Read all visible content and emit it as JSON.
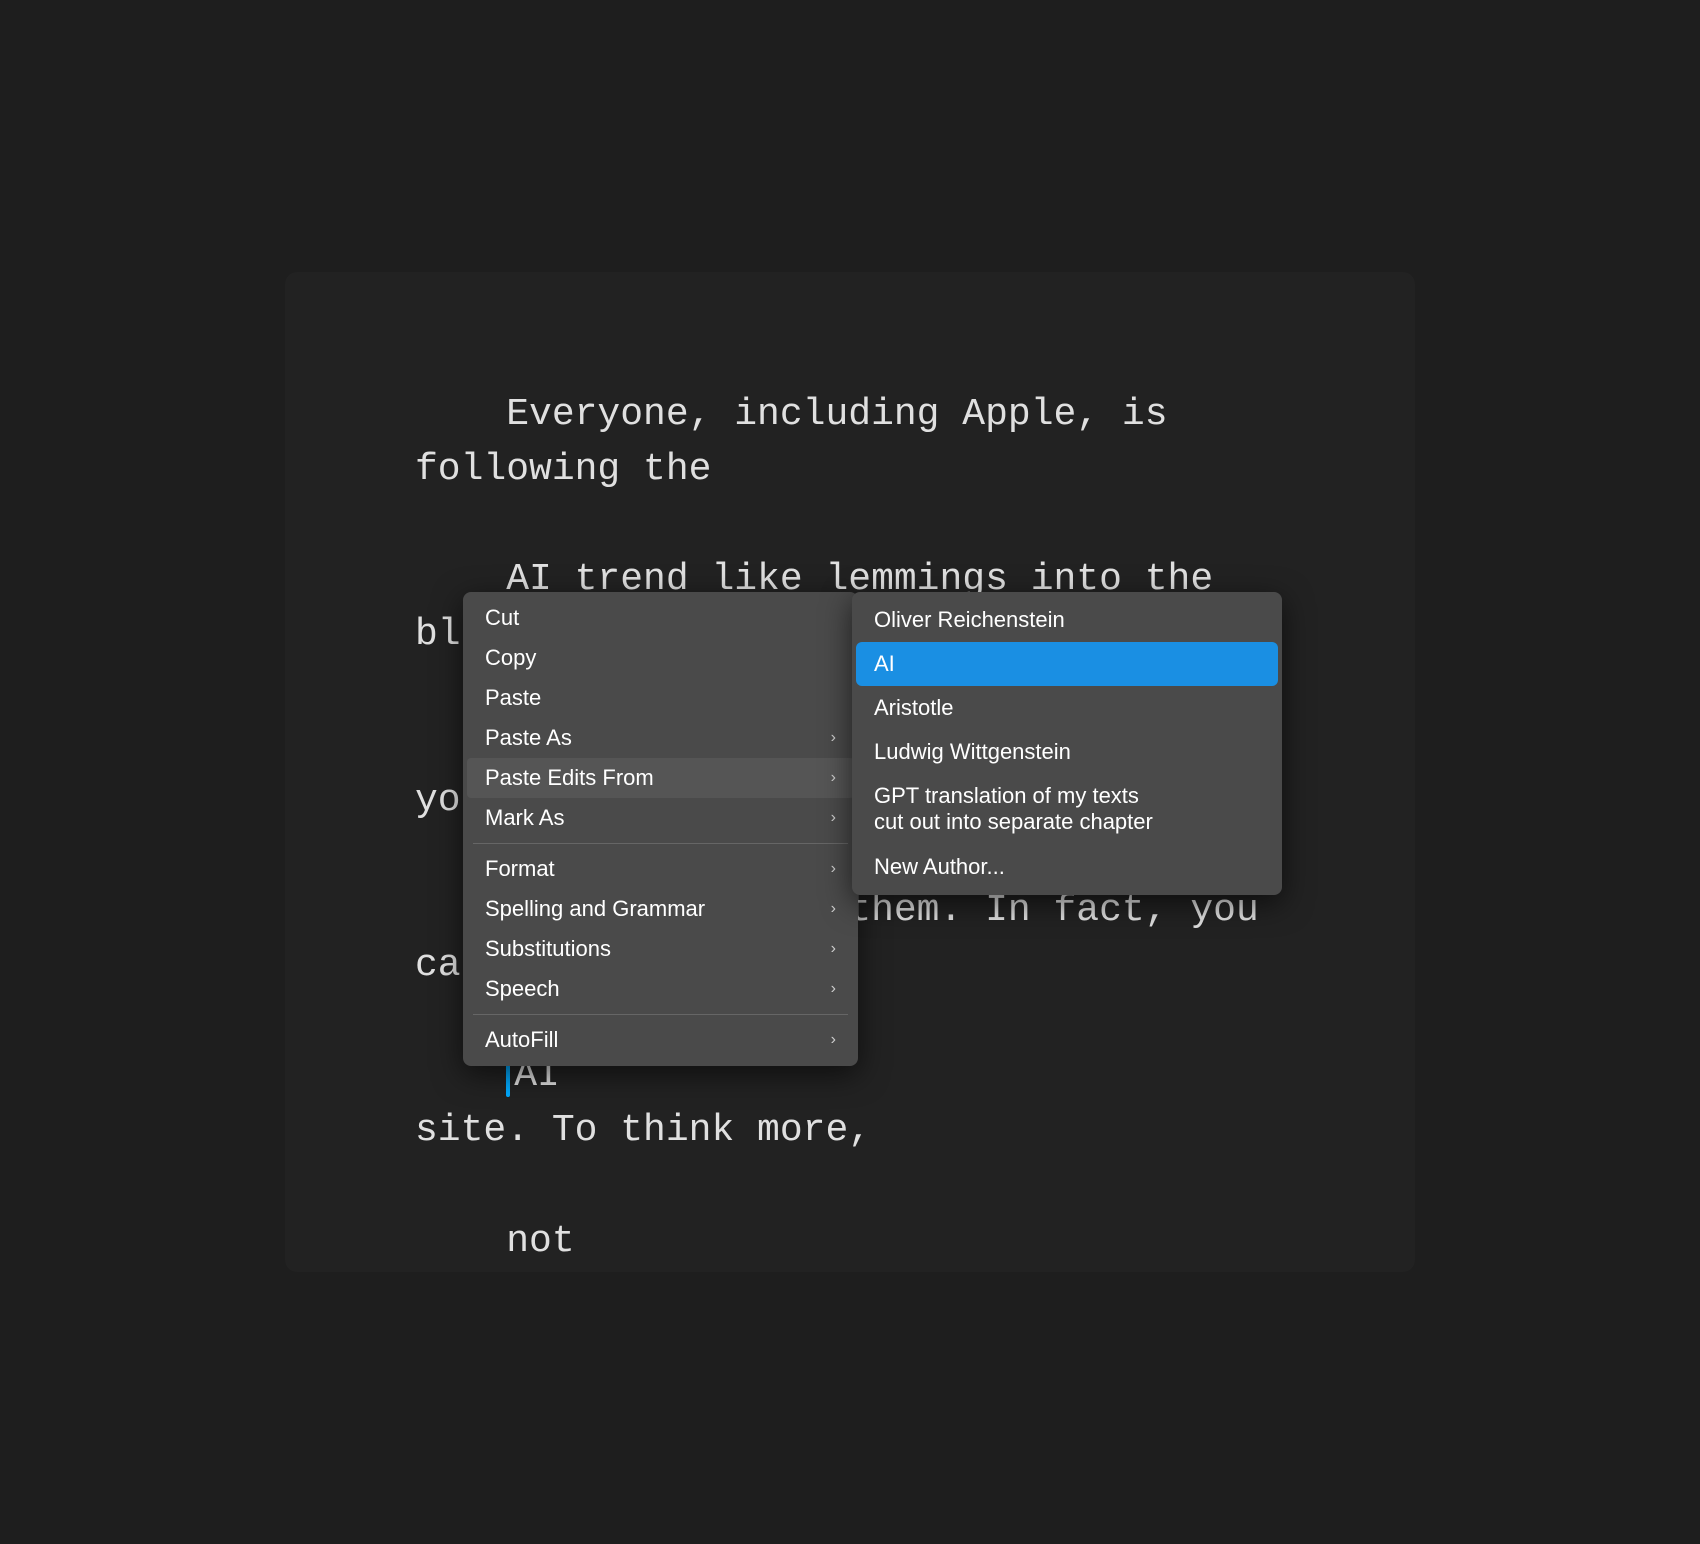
{
  "app": {
    "background_color": "#1e1e1e",
    "window_background": "#222222"
  },
  "text_editor": {
    "content": "Everyone, including Apple, is following the\nAI trend like lemmings into the black hole\nof AI sameness. You shouldn't and you don't\nneed to follow them. In fact, you can use\nAI                                site. To think more,\nnot"
  },
  "context_menu": {
    "items": [
      {
        "label": "Cut",
        "has_submenu": false
      },
      {
        "label": "Copy",
        "has_submenu": false
      },
      {
        "label": "Paste",
        "has_submenu": false
      },
      {
        "label": "Paste As",
        "has_submenu": true
      },
      {
        "label": "Paste Edits From",
        "has_submenu": true
      },
      {
        "label": "Mark As",
        "has_submenu": true
      },
      {
        "label": "Format",
        "has_submenu": true
      },
      {
        "label": "Spelling and Grammar",
        "has_submenu": true
      },
      {
        "label": "Substitutions",
        "has_submenu": true
      },
      {
        "label": "Speech",
        "has_submenu": true
      },
      {
        "label": "AutoFill",
        "has_submenu": true
      }
    ]
  },
  "submenu": {
    "items": [
      {
        "label": "Oliver Reichenstein",
        "selected": false
      },
      {
        "label": "AI",
        "selected": true
      },
      {
        "label": "Aristotle",
        "selected": false
      },
      {
        "label": "Ludwig Wittgenstein",
        "selected": false
      },
      {
        "label": "GPT translation of my texts\ncut out into separate chapter",
        "selected": false,
        "multi_line": true,
        "line1": "GPT translation of my texts",
        "line2": "cut out into separate chapter"
      },
      {
        "label": "New Author...",
        "selected": false
      }
    ]
  }
}
